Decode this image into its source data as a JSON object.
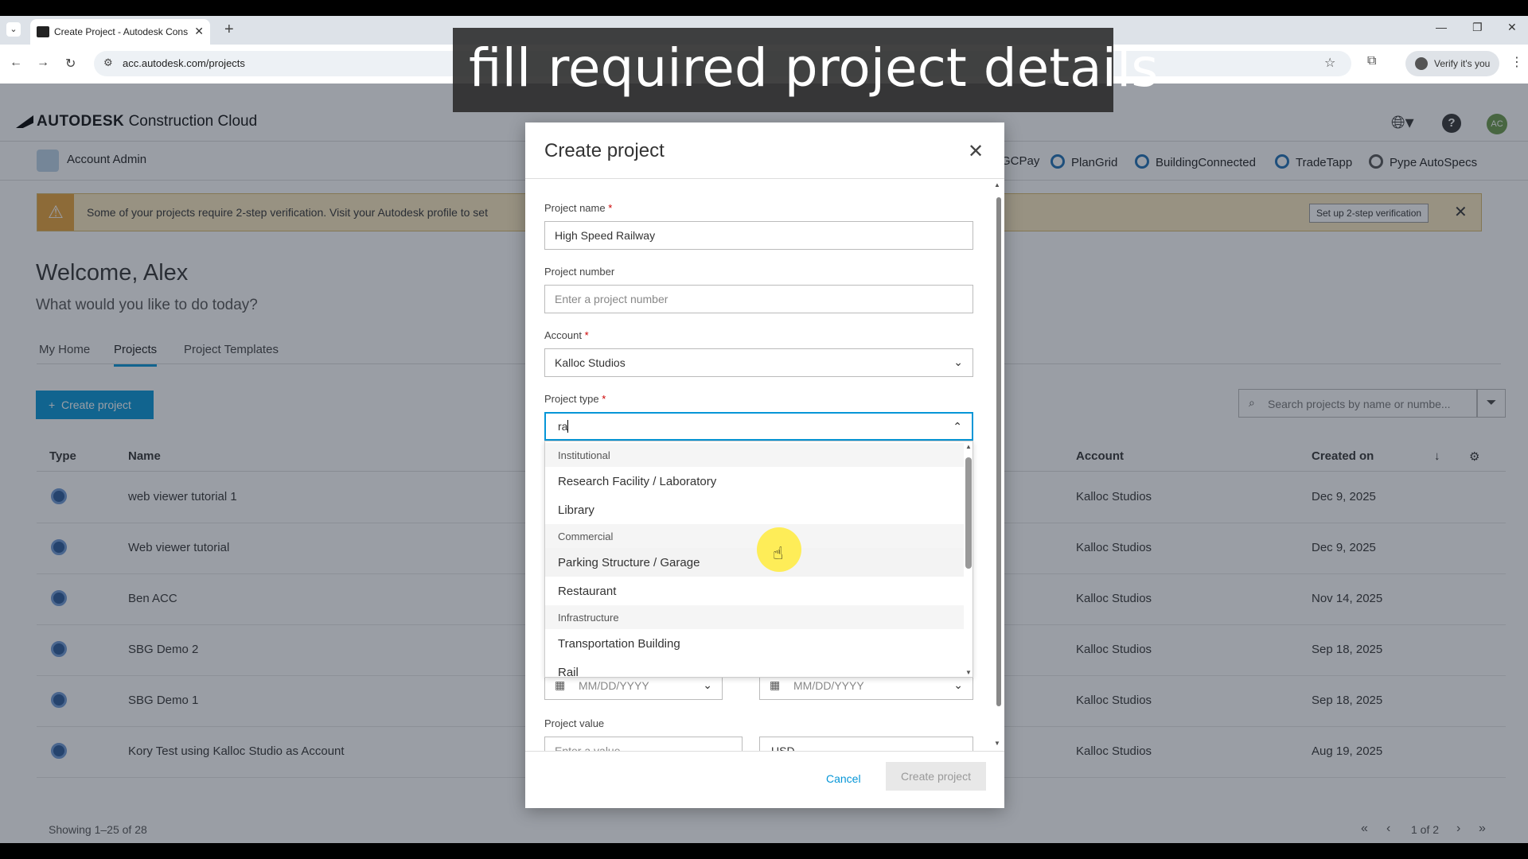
{
  "caption": "fill required project details",
  "browser": {
    "tab_title": "Create Project - Autodesk Construction Cloud",
    "url": "acc.autodesk.com/projects",
    "verify_label": "Verify it's you"
  },
  "app": {
    "brand_bold": "AUTODESK",
    "brand_rest": "Construction Cloud",
    "avatar": "AC",
    "account_admin": "Account Admin",
    "apps": [
      "GCPay",
      "PlanGrid",
      "BuildingConnected",
      "TradeTapp",
      "Pype AutoSpecs"
    ]
  },
  "banner": {
    "message": "Some of your projects require 2-step verification. Visit your Autodesk profile to set",
    "setup_label": "Set up 2-step verification"
  },
  "home": {
    "welcome": "Welcome, Alex",
    "subtitle": "What would you like to do today?",
    "tabs": [
      "My Home",
      "Projects",
      "Project Templates"
    ],
    "create_button": "Create project",
    "search_placeholder": "Search projects by name or numbe...",
    "columns": {
      "type": "Type",
      "name": "Name",
      "account": "Account",
      "created": "Created on"
    },
    "rows": [
      {
        "name": "web viewer tutorial 1",
        "account": "Kalloc Studios",
        "created": "Dec 9, 2025"
      },
      {
        "name": "Web viewer tutorial",
        "account": "Kalloc Studios",
        "created": "Dec 9, 2025"
      },
      {
        "name": "Ben ACC",
        "account": "Kalloc Studios",
        "created": "Nov 14, 2025"
      },
      {
        "name": "SBG Demo 2",
        "account": "Kalloc Studios",
        "created": "Sep 18, 2025"
      },
      {
        "name": "SBG Demo 1",
        "account": "Kalloc Studios",
        "created": "Sep 18, 2025"
      },
      {
        "name": "Kory Test using Kalloc Studio as Account",
        "account": "Kalloc Studios",
        "created": "Aug 19, 2025"
      }
    ],
    "showing": "Showing 1–25 of 28",
    "page": "1 of 2"
  },
  "modal": {
    "title": "Create project",
    "project_name_label": "Project name",
    "project_name_value": "High Speed Railway",
    "project_number_label": "Project number",
    "project_number_placeholder": "Enter a project number",
    "account_label": "Account",
    "account_value": "Kalloc Studios",
    "project_type_label": "Project type",
    "project_type_query": "ra",
    "dropdown": [
      {
        "kind": "group",
        "label": "Institutional"
      },
      {
        "kind": "item",
        "label": "Research Facility / Laboratory"
      },
      {
        "kind": "item",
        "label": "Library"
      },
      {
        "kind": "group",
        "label": "Commercial"
      },
      {
        "kind": "item",
        "label": "Parking Structure / Garage"
      },
      {
        "kind": "item",
        "label": "Restaurant"
      },
      {
        "kind": "group",
        "label": "Infrastructure"
      },
      {
        "kind": "item",
        "label": "Transportation Building"
      },
      {
        "kind": "item",
        "label": "Rail"
      }
    ],
    "date_placeholder": "MM/DD/YYYY",
    "project_value_label": "Project value",
    "value_placeholder": "Enter a value",
    "currency": "USD",
    "cancel": "Cancel",
    "create": "Create project"
  }
}
